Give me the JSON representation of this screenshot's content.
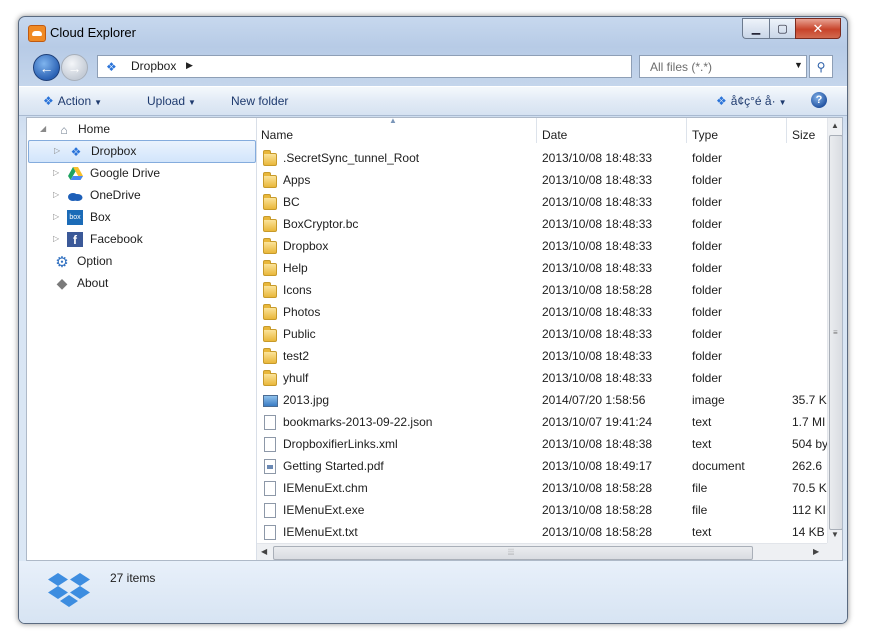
{
  "window": {
    "title": "Cloud Explorer"
  },
  "nav": {
    "address": "Dropbox",
    "filter": "All files (*.*)"
  },
  "toolbar": {
    "action": "Action",
    "upload": "Upload",
    "new_folder": "New folder",
    "language": "å¢ç°é å·"
  },
  "tree": {
    "items": [
      {
        "label": "Home",
        "icon": "home-icon"
      },
      {
        "label": "Dropbox",
        "icon": "dropbox-icon",
        "selected": true
      },
      {
        "label": "Google Drive",
        "icon": "google-drive-icon"
      },
      {
        "label": "OneDrive",
        "icon": "onedrive-icon"
      },
      {
        "label": "Box",
        "icon": "box-icon"
      },
      {
        "label": "Facebook",
        "icon": "facebook-icon"
      },
      {
        "label": "Option",
        "icon": "gear-icon"
      },
      {
        "label": "About",
        "icon": "info-icon"
      }
    ]
  },
  "columns": {
    "name": "Name",
    "date": "Date",
    "type": "Type",
    "size": "Size"
  },
  "files": [
    {
      "name": ".SecretSync_tunnel_Root",
      "date": "2013/10/08 18:48:33",
      "type": "folder",
      "size": "",
      "icon": "folder"
    },
    {
      "name": "Apps",
      "date": "2013/10/08 18:48:33",
      "type": "folder",
      "size": "",
      "icon": "folder"
    },
    {
      "name": "BC",
      "date": "2013/10/08 18:48:33",
      "type": "folder",
      "size": "",
      "icon": "folder"
    },
    {
      "name": "BoxCryptor.bc",
      "date": "2013/10/08 18:48:33",
      "type": "folder",
      "size": "",
      "icon": "folder"
    },
    {
      "name": "Dropbox",
      "date": "2013/10/08 18:48:33",
      "type": "folder",
      "size": "",
      "icon": "folder"
    },
    {
      "name": "Help",
      "date": "2013/10/08 18:48:33",
      "type": "folder",
      "size": "",
      "icon": "folder"
    },
    {
      "name": "Icons",
      "date": "2013/10/08 18:58:28",
      "type": "folder",
      "size": "",
      "icon": "folder"
    },
    {
      "name": "Photos",
      "date": "2013/10/08 18:48:33",
      "type": "folder",
      "size": "",
      "icon": "folder"
    },
    {
      "name": "Public",
      "date": "2013/10/08 18:48:33",
      "type": "folder",
      "size": "",
      "icon": "folder"
    },
    {
      "name": "test2",
      "date": "2013/10/08 18:48:33",
      "type": "folder",
      "size": "",
      "icon": "folder"
    },
    {
      "name": "yhulf",
      "date": "2013/10/08 18:48:33",
      "type": "folder",
      "size": "",
      "icon": "folder"
    },
    {
      "name": "2013.jpg",
      "date": "2014/07/20 1:58:56",
      "type": "image",
      "size": "35.7 K",
      "icon": "image"
    },
    {
      "name": "bookmarks-2013-09-22.json",
      "date": "2013/10/07 19:41:24",
      "type": "text",
      "size": "1.7 MI",
      "icon": "doc"
    },
    {
      "name": "DropboxifierLinks.xml",
      "date": "2013/10/08 18:48:38",
      "type": "text",
      "size": "504 by",
      "icon": "doc"
    },
    {
      "name": "Getting Started.pdf",
      "date": "2013/10/08 18:49:17",
      "type": "document",
      "size": "262.6",
      "icon": "pdf"
    },
    {
      "name": "IEMenuExt.chm",
      "date": "2013/10/08 18:58:28",
      "type": "file",
      "size": "70.5 K",
      "icon": "doc"
    },
    {
      "name": "IEMenuExt.exe",
      "date": "2013/10/08 18:58:28",
      "type": "file",
      "size": "112 KI",
      "icon": "doc"
    },
    {
      "name": "IEMenuExt.txt",
      "date": "2013/10/08 18:58:28",
      "type": "text",
      "size": "14 KB",
      "icon": "doc"
    }
  ],
  "status": {
    "count": "27 items"
  }
}
